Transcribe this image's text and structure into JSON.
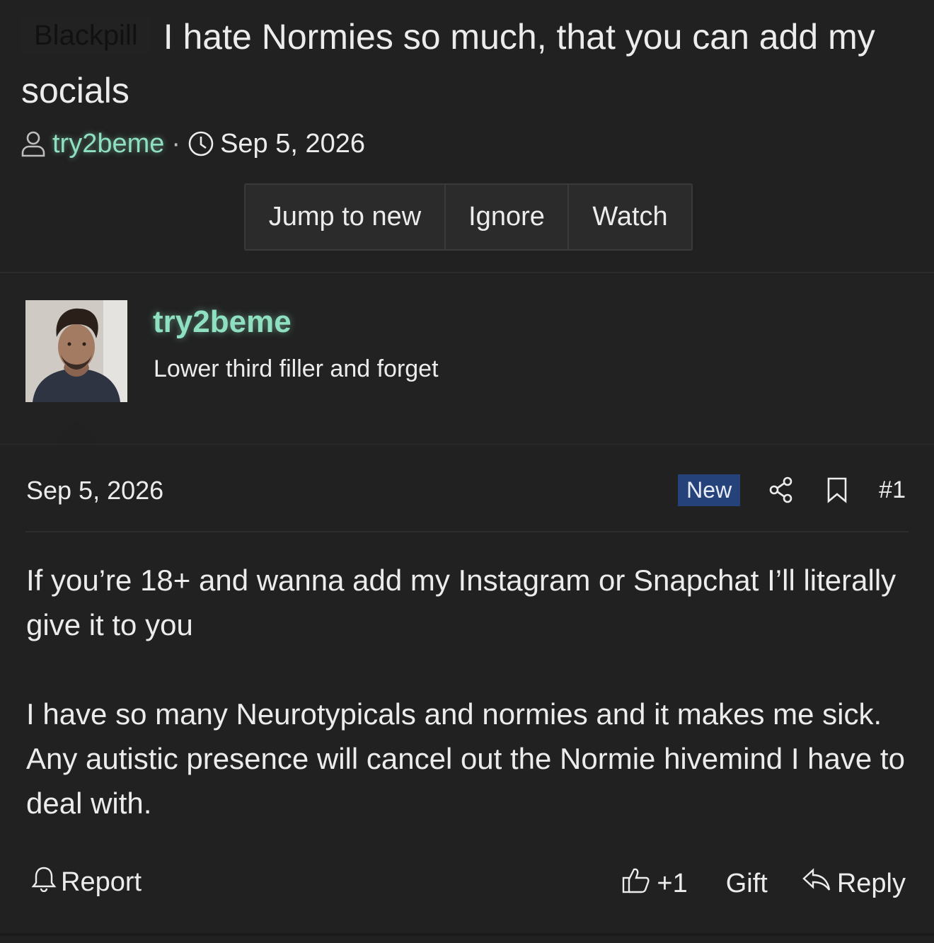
{
  "thread": {
    "prefix": "Blackpill",
    "title": "I hate Normies so much, that you can add my socials",
    "author": "try2beme",
    "date": "Sep 5, 2026"
  },
  "thread_actions": {
    "jump_to_new": "Jump to new",
    "ignore": "Ignore",
    "watch": "Watch"
  },
  "user": {
    "name": "try2beme",
    "title": "Lower third filler and forget"
  },
  "post": {
    "date": "Sep 5, 2026",
    "badge": "New",
    "number": "#1",
    "paragraphs": [
      "If you’re 18+ and wanna add my Instagram or Snapchat I’ll literally give it to you",
      "I have so many Neurotypicals and normies and it makes me sick. Any autistic presence will cancel out the Normie hivemind I have to deal with."
    ],
    "report_label": "Report",
    "reaction_count": "+1",
    "gift_label": "Gift",
    "reply_label": "Reply"
  },
  "colors": {
    "background": "#212121",
    "username": "#8ee0c0",
    "badge_new": "#25427a"
  },
  "icons": [
    "user-icon",
    "clock-icon",
    "share-icon",
    "bookmark-icon",
    "bell-icon",
    "thumbs-up-icon",
    "reply-icon"
  ]
}
